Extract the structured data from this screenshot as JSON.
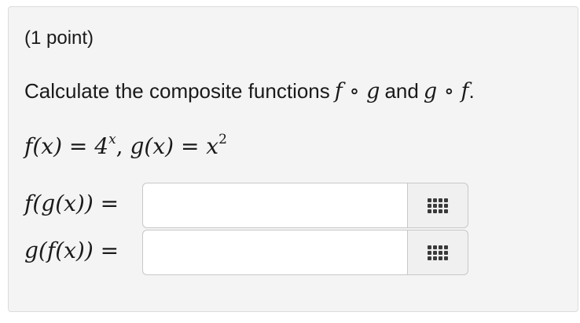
{
  "problem": {
    "points_label": "(1 point)",
    "instruction": {
      "before": "Calculate the composite functions",
      "composition_fg": "f ∘ g",
      "joiner": "and",
      "composition_gf": "g ∘ f",
      "end": "."
    },
    "definitions": {
      "f_lhs": "f(x) = 4",
      "f_exponent": "x",
      "separator": ",",
      "g_lhs": "g(x) = x",
      "g_exponent": "2"
    },
    "answers": [
      {
        "label": "f(g(x)) =",
        "value": "",
        "placeholder": "",
        "editor_icon": "grid-icon"
      },
      {
        "label": "g(f(x)) =",
        "value": "",
        "placeholder": "",
        "editor_icon": "grid-icon"
      }
    ]
  },
  "colors": {
    "panel_background": "#f4f4f4",
    "panel_border": "#dcdcdc",
    "text": "#1a1a1a",
    "input_background": "#ffffff",
    "button_background": "#f0f0f0"
  }
}
